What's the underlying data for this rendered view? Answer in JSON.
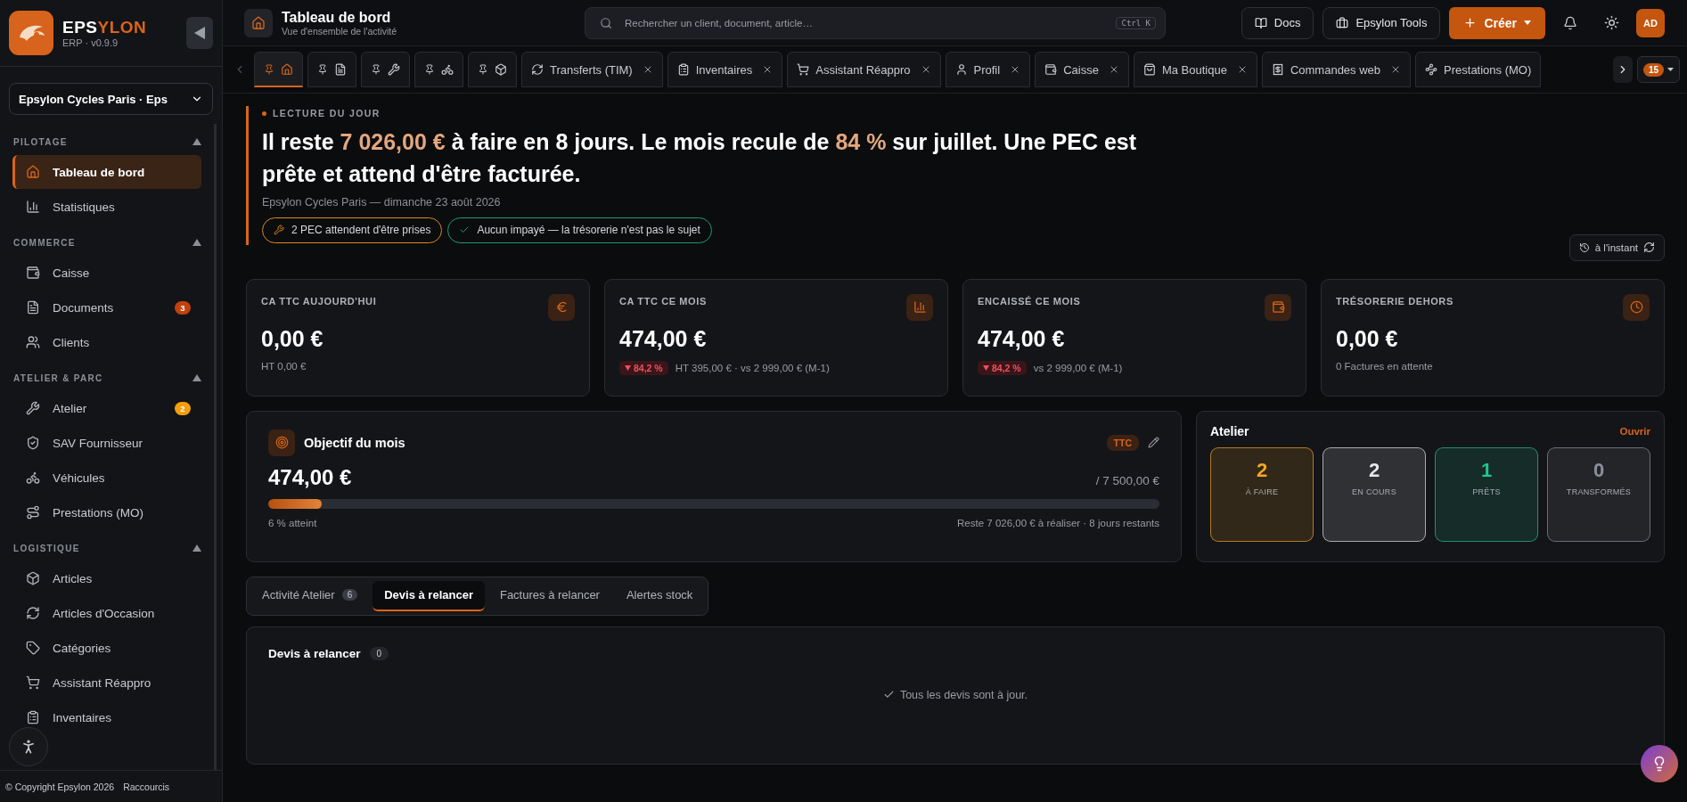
{
  "brand": {
    "name_main": "EPS",
    "name_accent": "YLON",
    "version": "ERP · v0.9.9"
  },
  "store_select": {
    "value": "Epsylon Cycles Paris · Eps"
  },
  "sidebar": {
    "sections": [
      {
        "title": "PILOTAGE",
        "expanded": true,
        "items": [
          {
            "label": "Tableau de bord",
            "selected": true
          },
          {
            "label": "Statistiques",
            "selected": false
          }
        ]
      },
      {
        "title": "COMMERCE",
        "expanded": true,
        "items": [
          {
            "label": "Caisse",
            "selected": false
          },
          {
            "label": "Documents",
            "selected": false,
            "badge": "3",
            "color": "#c2410c"
          },
          {
            "label": "Clients",
            "selected": false
          }
        ]
      },
      {
        "title": "ATELIER & PARC",
        "expanded": true,
        "items": [
          {
            "label": "Atelier",
            "selected": false,
            "badge": "2",
            "color": "#f59e0b"
          },
          {
            "label": "SAV Fournisseur",
            "selected": false
          },
          {
            "label": "Véhicules",
            "selected": false
          },
          {
            "label": "Prestations (MO)",
            "selected": false
          }
        ]
      },
      {
        "title": "LOGISTIQUE",
        "expanded": true,
        "items": [
          {
            "label": "Articles",
            "selected": false
          },
          {
            "label": "Articles d'Occasion",
            "selected": false
          },
          {
            "label": "Catégories",
            "selected": false
          },
          {
            "label": "Assistant Réappro",
            "selected": false
          },
          {
            "label": "Inventaires",
            "selected": false
          }
        ]
      }
    ],
    "footer": {
      "copyright": "© Copyright Epsylon 2026",
      "link": "Raccourcis"
    }
  },
  "header": {
    "title": "Tableau de bord",
    "subtitle": "Vue d'ensemble de l'activité"
  },
  "search": {
    "placeholder": "Rechercher un client, document, article…",
    "shortcut": "Ctrl K"
  },
  "top_buttons": {
    "docs": "Docs",
    "tools": "Epsylon Tools",
    "create": "Créer",
    "avatar": "AD"
  },
  "open_tabs": [
    {
      "kind": "pinned",
      "selected": true
    },
    {
      "kind": "pinned",
      "selected": false
    },
    {
      "kind": "pinned",
      "selected": false
    },
    {
      "kind": "pinned",
      "selected": false
    },
    {
      "kind": "pinned",
      "selected": false
    },
    {
      "kind": "closable",
      "label": "Transferts (TIM)",
      "selected": false
    },
    {
      "kind": "closable",
      "label": "Inventaires",
      "selected": false
    },
    {
      "kind": "closable",
      "label": "Assistant Réappro",
      "selected": false
    },
    {
      "kind": "closable",
      "label": "Profil",
      "selected": false
    },
    {
      "kind": "closable",
      "label": "Caisse",
      "selected": false
    },
    {
      "kind": "closable",
      "label": "Ma Boutique",
      "selected": false
    },
    {
      "kind": "closable",
      "label": "Commandes web",
      "selected": false
    },
    {
      "kind": "cut",
      "label": "Prestations (MO)",
      "selected": false
    }
  ],
  "tab_count": "15",
  "briefing": {
    "eyebrow": "LECTURE DU JOUR",
    "headline": [
      {
        "text": "Il reste ",
        "highlight": false
      },
      {
        "text": "7 026,00 €",
        "highlight": true
      },
      {
        "text": " à faire en 8 jours. Le mois recule de ",
        "highlight": false
      },
      {
        "text": "84 %",
        "highlight": true
      },
      {
        "text": " sur juillet. Une PEC est prête et attend d'être facturée.",
        "highlight": false
      }
    ],
    "meta": "Epsylon Cycles Paris — dimanche 23 août 2026",
    "chips": [
      {
        "text": "2 PEC attendent d'être prises",
        "color": "#d98a1a"
      },
      {
        "text": "Aucun impayé — la trésorerie n'est pas le sujet",
        "color": "#1f9d6a"
      }
    ],
    "refresh": "à l'instant"
  },
  "kpis": [
    {
      "label": "CA TTC AUJOURD'HUI",
      "value": "0,00 €",
      "sub": "HT 0,00 €"
    },
    {
      "label": "CA TTC CE MOIS",
      "value": "474,00 €",
      "delta": "84,2 %",
      "sub": "HT 395,00 € · vs 2 999,00 € (M-1)"
    },
    {
      "label": "ENCAISSÉ CE MOIS",
      "value": "474,00 €",
      "delta": "84,2 %",
      "sub": "vs 2 999,00 € (M-1)"
    },
    {
      "label": "TRÉSORERIE DEHORS",
      "value": "0,00 €",
      "sub": "0 Factures en attente"
    }
  ],
  "goal": {
    "title": "Objectif du mois",
    "tag": "TTC",
    "value": "474,00 €",
    "target": "/ 7 500,00 €",
    "level": 0.06,
    "reached": "6 % atteint",
    "remaining": "Reste 7 026,00 € à réaliser · 8 jours restants"
  },
  "workshop": {
    "title": "Atelier",
    "link": "Ouvrir",
    "tiles": [
      {
        "count": "2",
        "label": "À FAIRE",
        "color": "#f5a524"
      },
      {
        "count": "2",
        "label": "EN COURS",
        "color": "#e5e7eb"
      },
      {
        "count": "1",
        "label": "PRÊTS",
        "color": "#22c58b"
      },
      {
        "count": "0",
        "label": "TRANSFORMÉS",
        "color": "#8b9099"
      }
    ]
  },
  "section_tabs": [
    {
      "label": "Activité Atelier",
      "count": "6",
      "selected": false
    },
    {
      "label": "Devis à relancer",
      "selected": true
    },
    {
      "label": "Factures à relancer",
      "selected": false
    },
    {
      "label": "Alertes stock",
      "selected": false
    }
  ],
  "quotes_panel": {
    "title": "Devis à relancer",
    "count": "0",
    "empty": "Tous les devis sont à jour."
  }
}
